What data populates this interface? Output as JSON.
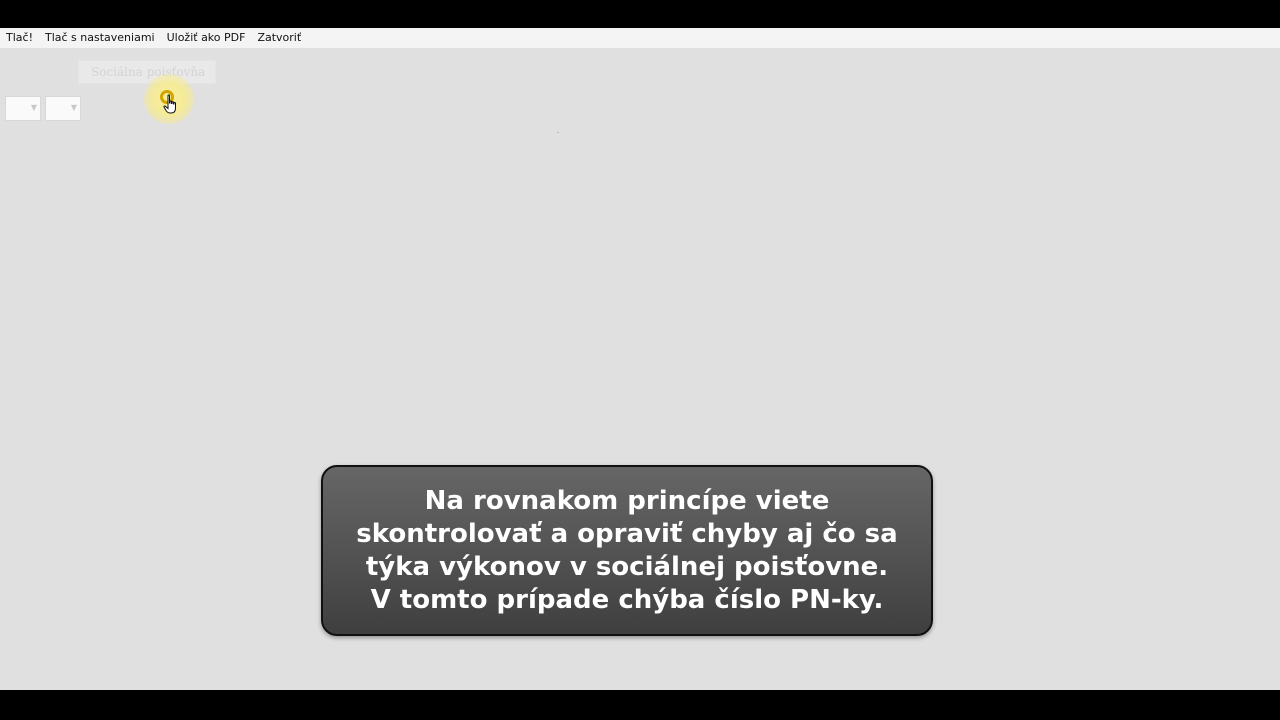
{
  "menubar": {
    "items": [
      {
        "label": "Tlač!"
      },
      {
        "label": "Tlač s nastaveniami"
      },
      {
        "label": "Uložiť ako PDF"
      },
      {
        "label": "Zatvoriť"
      }
    ]
  },
  "toolbar": {
    "faded_button_label": "Sociálna poisťovňa"
  },
  "dropdowns": [
    {
      "value": ""
    },
    {
      "value": ""
    }
  ],
  "caption": {
    "lines": [
      "Na rovnakom princípe viete",
      "skontrolovať a opraviť chyby aj čo sa",
      "týka výkonov v sociálnej poisťovne.",
      "V tomto prípade chýba číslo PN-ky."
    ]
  },
  "icons": {
    "cursor": "hand-pointer-icon",
    "dropdown_caret": "chevron-down-icon"
  },
  "colors": {
    "background": "#e0e0e0",
    "menubar": "#f4f4f4",
    "caption_bg": "#555555",
    "caption_text": "#ffffff",
    "cursor_highlight": "#f8ec8c"
  }
}
